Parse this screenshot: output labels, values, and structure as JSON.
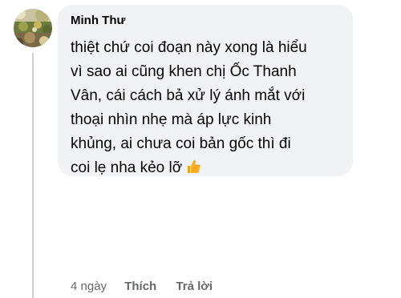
{
  "comment": {
    "author": "Minh Thư",
    "text_lines": [
      "thiệt chứ coi đoạn này xong là hiểu",
      "vì sao ai cũng khen chị Ốc Thanh",
      "Vân, cái cách bả xử lý ánh mắt với",
      "thoại nhìn nhẹ mà áp lực kinh",
      "khủng, ai chưa coi bản gốc thì đi",
      "coi lẹ nha kẻo lỡ"
    ],
    "emoji": "thumbs-up-icon"
  },
  "actions": {
    "timestamp": "4 ngày",
    "like_label": "Thích",
    "reply_label": "Trả lời"
  },
  "colors": {
    "bubble_background": "#f0f2f5",
    "thread_line": "#ced0d4",
    "text_primary": "#050505",
    "text_secondary": "#65676b",
    "thumb_yellow": "#f7b125"
  }
}
